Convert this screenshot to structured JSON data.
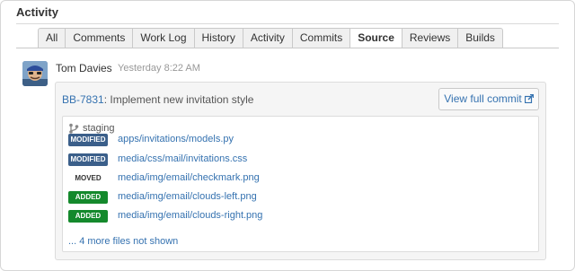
{
  "section": {
    "title": "Activity"
  },
  "tabs": [
    {
      "label": "All",
      "active": false
    },
    {
      "label": "Comments",
      "active": false
    },
    {
      "label": "Work Log",
      "active": false
    },
    {
      "label": "History",
      "active": false
    },
    {
      "label": "Activity",
      "active": false
    },
    {
      "label": "Commits",
      "active": false
    },
    {
      "label": "Source",
      "active": true
    },
    {
      "label": "Reviews",
      "active": false
    },
    {
      "label": "Builds",
      "active": false
    }
  ],
  "entry": {
    "author": "Tom Davies",
    "timestamp": "Yesterday 8:22 AM",
    "commit": {
      "key": "BB-7831",
      "separator": ":",
      "message": " Implement new invitation style",
      "view_button": "View full commit"
    },
    "branch": "staging",
    "files": [
      {
        "status": "MODIFIED",
        "status_color": "#3b5f8a",
        "status_text_color": "#ffffff",
        "path": "apps/invitations/models.py"
      },
      {
        "status": "MODIFIED",
        "status_color": "#3b5f8a",
        "status_text_color": "#ffffff",
        "path": "media/css/mail/invitations.css"
      },
      {
        "status": "MOVED",
        "status_color": "#ffffff",
        "status_text_color": "#333333",
        "path": "media/img/email/checkmark.png"
      },
      {
        "status": "ADDED",
        "status_color": "#14892c",
        "status_text_color": "#ffffff",
        "path": "media/img/email/clouds-left.png"
      },
      {
        "status": "ADDED",
        "status_color": "#14892c",
        "status_text_color": "#ffffff",
        "path": "media/img/email/clouds-right.png"
      }
    ],
    "more_files": "... 4 more files not shown"
  },
  "icons": {
    "avatar": "user-avatar",
    "branch": "branch-icon",
    "external": "external-link-icon"
  },
  "colors": {
    "link": "#3572b0",
    "modified": "#3b5f8a",
    "added": "#14892c"
  }
}
